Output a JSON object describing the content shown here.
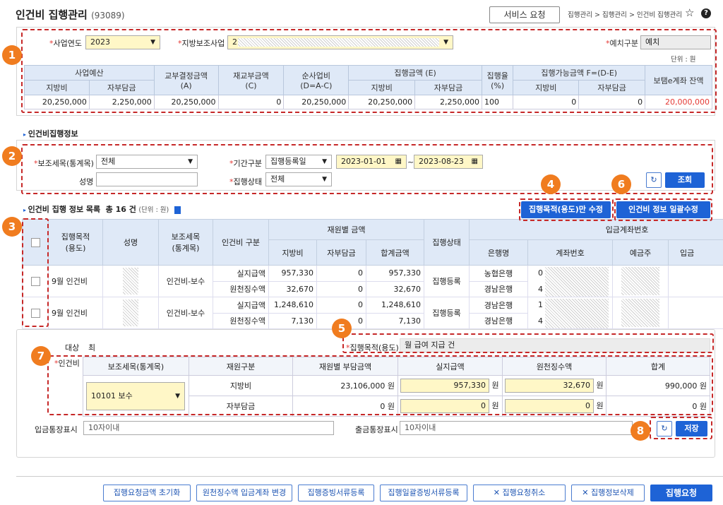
{
  "header": {
    "title": "인건비 집행관리",
    "code": "(93089)",
    "service_btn": "서비스 요청",
    "breadcrumb": "집행관리 > 집행관리 > 인건비 집행관리",
    "star": "☆",
    "help": "?"
  },
  "filter": {
    "year_label": "사업연도",
    "year_value": "2023",
    "subsidy_label": "지방보조사업",
    "subsidy_value": "2",
    "deposit_label": "예치구분",
    "deposit_value": "예치",
    "unit": "단위 : 원"
  },
  "budget_table": {
    "h1": [
      "사업예산",
      "교부결정금액\n(A)",
      "재교부금액\n(C)",
      "순사업비\n(D=A-C)",
      "집행금액 (E)",
      "집행율\n(%)",
      "집행가능금액 F=(D-E)",
      "보탬e계좌 잔액"
    ],
    "h2": [
      "지방비",
      "자부담금",
      "지방비",
      "자부담금",
      "지방비",
      "자부담금"
    ],
    "row": [
      "20,250,000",
      "2,250,000",
      "20,250,000",
      "0",
      "20,250,000",
      "20,250,000",
      "2,250,000",
      "100",
      "0",
      "0",
      "20,000,000"
    ]
  },
  "section1_title": "인건비집행정보",
  "search": {
    "sub_item_label": "보조세목(통계목)",
    "sub_item_value": "전체",
    "name_label": "성명",
    "name_value": "",
    "period_label": "기간구분",
    "period_value": "집행등록일",
    "date_from": "2023-01-01",
    "date_to": "2023-08-23",
    "tilde": "~",
    "status_label": "집행상태",
    "status_value": "전체",
    "reset_icon": "↻",
    "search_btn": "조회"
  },
  "list": {
    "title": "인건비 집행 정보 목록",
    "count_text": "총 16 건",
    "unit": "(단위 : 원)",
    "btn_edit_purpose": "집행목적(용도)만 수정",
    "btn_bulk_edit": "인건비 정보 일괄수정",
    "headers": {
      "purpose": "집행목적\n(용도)",
      "name": "성명",
      "sub_item": "보조세목\n(통계목)",
      "type": "인건비 구분",
      "funds": "재원별 금액",
      "local": "지방비",
      "self": "자부담금",
      "total": "합계금액",
      "status": "집행상태",
      "account": "입금계좌번호",
      "bank": "은행명",
      "accno": "계좌번호",
      "holder": "예금주",
      "more": "입금"
    },
    "rows": [
      {
        "purpose": "9월 인건비",
        "sub_item": "인건비-보수",
        "status": "집행등록",
        "lines": [
          {
            "type": "실지급액",
            "local": "957,330",
            "self": "0",
            "total": "957,330",
            "bank": "농협은행",
            "acc": "0"
          },
          {
            "type": "원천징수액",
            "local": "32,670",
            "self": "0",
            "total": "32,670",
            "bank": "경남은행",
            "acc": "4"
          }
        ]
      },
      {
        "purpose": "9월 인건비",
        "sub_item": "인건비-보수",
        "status": "집행등록",
        "lines": [
          {
            "type": "실지급액",
            "local": "1,248,610",
            "self": "0",
            "total": "1,248,610",
            "bank": "경남은행",
            "acc": "1"
          },
          {
            "type": "원천징수액",
            "local": "7,130",
            "self": "0",
            "total": "7,130",
            "bank": "경남은행",
            "acc": "4"
          }
        ]
      }
    ]
  },
  "detail": {
    "target_label": "대상",
    "target_value": "최",
    "purpose_label": "집행목적(용도)",
    "purpose_value": "월 급여 지급 건",
    "labor_label": "인건비",
    "headers": [
      "보조세목(통계목)",
      "재원구분",
      "재원별 부담금액",
      "실지급액",
      "원천징수액",
      "합계"
    ],
    "sub_item_value": "10101 보수",
    "rows": [
      {
        "source": "지방비",
        "burden": "23,106,000 원",
        "paid": "957,330",
        "withheld": "32,670",
        "total": "990,000 원"
      },
      {
        "source": "자부담금",
        "burden": "0 원",
        "paid": "0",
        "withheld": "0",
        "total": "0 원"
      }
    ],
    "won": "원",
    "in_label": "입금통장표시",
    "in_placeholder": "10자이내",
    "out_label": "출금통장표시",
    "out_placeholder": "10자이내",
    "save_btn": "저장"
  },
  "bottom": {
    "b1": "집행요청금액 초기화",
    "b2": "원천징수액 입금계좌 변경",
    "b3": "집행증빙서류등록",
    "b4": "집행일괄증빙서류등록",
    "b5": "집행요청취소",
    "b6": "집행정보삭제",
    "b7": "집행요청",
    "x": "✕"
  },
  "badges": [
    "1",
    "2",
    "3",
    "4",
    "5",
    "6",
    "7",
    "8"
  ],
  "colors": {
    "accent": "#1e63d6",
    "badge": "#f07c1f",
    "dash": "#c62828",
    "balance": "#e53935"
  }
}
